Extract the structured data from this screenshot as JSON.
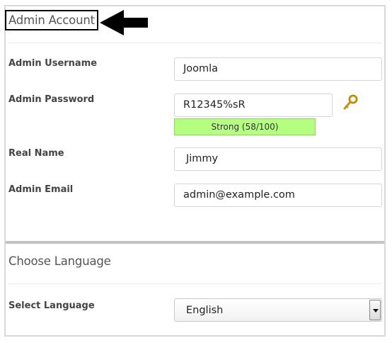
{
  "admin_account": {
    "title": "Admin Account",
    "username": {
      "label": "Admin Username",
      "value": "Joomla"
    },
    "password": {
      "label": "Admin Password",
      "value": "R12345%sR",
      "strength": "Strong (58/100)"
    },
    "real_name": {
      "label": "Real Name",
      "value": "Jimmy"
    },
    "email": {
      "label": "Admin Email",
      "value": "admin@example.com"
    }
  },
  "language": {
    "title": "Choose Language",
    "label": "Select Language",
    "selected": "English"
  },
  "colors": {
    "strength_fill": "#b4ff82",
    "key_icon": "#d4a017",
    "highlight_border": "#000000"
  },
  "icons": {
    "generate_password": "key-icon",
    "pointer": "arrow-left-icon"
  }
}
